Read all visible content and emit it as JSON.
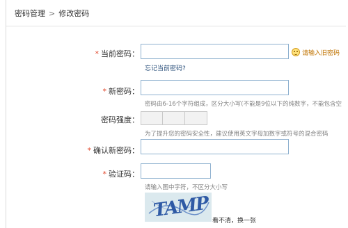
{
  "breadcrumb": {
    "parent": "密码管理",
    "separator": ">",
    "current": "修改密码"
  },
  "form": {
    "required_mark": "*",
    "current_password": {
      "label": "当前密码：",
      "value": "",
      "forgot_link": "忘记当前密码?",
      "tip": "请输入旧密码",
      "tip_icon": "smile-icon"
    },
    "new_password": {
      "label": "新密码：",
      "value": "",
      "hint": "密码由6-16个字符组成，区分大小写(不能是9位以下的纯数字，不能包含空"
    },
    "strength": {
      "label": "密码强度：",
      "segments": 3,
      "hint": "为了提升您的密码安全性，建议使用英文字母加数字或符号的混合密码"
    },
    "confirm_password": {
      "label": "确认新密码：",
      "value": ""
    },
    "captcha": {
      "label": "验证码：",
      "value": "",
      "hint": "请输入图中字符，不区分大小写",
      "image_text": "TAMP",
      "refresh_link": "看不清，换一张"
    }
  },
  "colors": {
    "required": "#e0462a",
    "input_border": "#8fb1cf",
    "tip": "#c07300",
    "link": "#2a4f7a"
  }
}
